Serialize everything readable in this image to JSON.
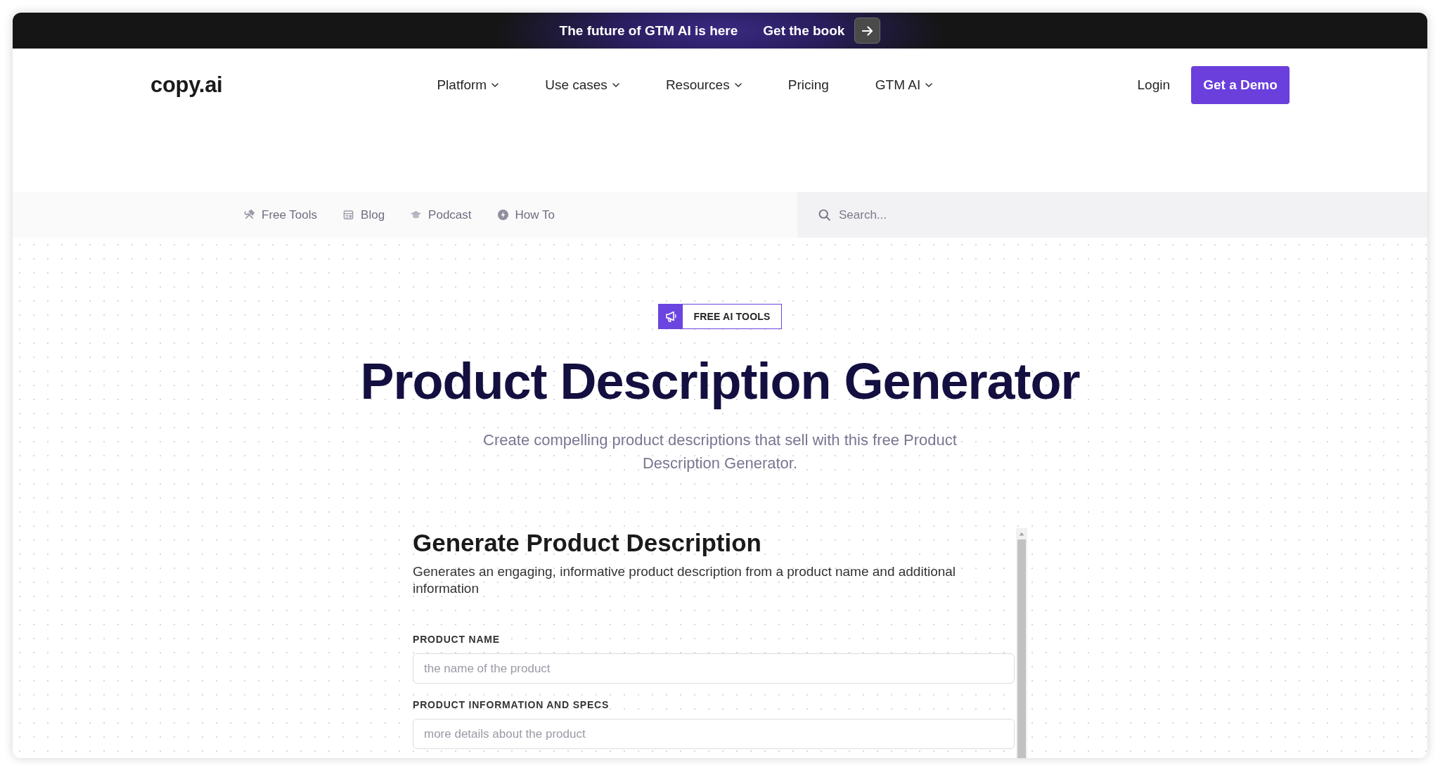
{
  "announcement": {
    "text": "The future of GTM AI is here",
    "link": "Get the book"
  },
  "header": {
    "logo": "copy.ai",
    "nav": [
      {
        "label": "Platform",
        "has_menu": true
      },
      {
        "label": "Use cases",
        "has_menu": true
      },
      {
        "label": "Resources",
        "has_menu": true
      },
      {
        "label": "Pricing",
        "has_menu": false
      },
      {
        "label": "GTM AI",
        "has_menu": true
      }
    ],
    "login": "Login",
    "cta": "Get a Demo"
  },
  "subnav": {
    "links": [
      {
        "label": "Free Tools",
        "kind": "tools"
      },
      {
        "label": "Blog",
        "kind": "blog"
      },
      {
        "label": "Podcast",
        "kind": "podcast"
      },
      {
        "label": "How To",
        "kind": "howto"
      }
    ],
    "search": {
      "placeholder": "Search..."
    }
  },
  "hero": {
    "badge": "FREE AI TOOLS",
    "title": "Product Description Generator",
    "subtitle": "Create compelling product descriptions that sell with this free Product Description Generator."
  },
  "tool_form": {
    "title": "Generate Product Description",
    "description": "Generates an engaging, informative product description from a product name and additional information",
    "fields": [
      {
        "label": "PRODUCT NAME",
        "placeholder": "the name of the product"
      },
      {
        "label": "PRODUCT INFORMATION AND SPECS",
        "placeholder": "more details about the product"
      }
    ]
  }
}
